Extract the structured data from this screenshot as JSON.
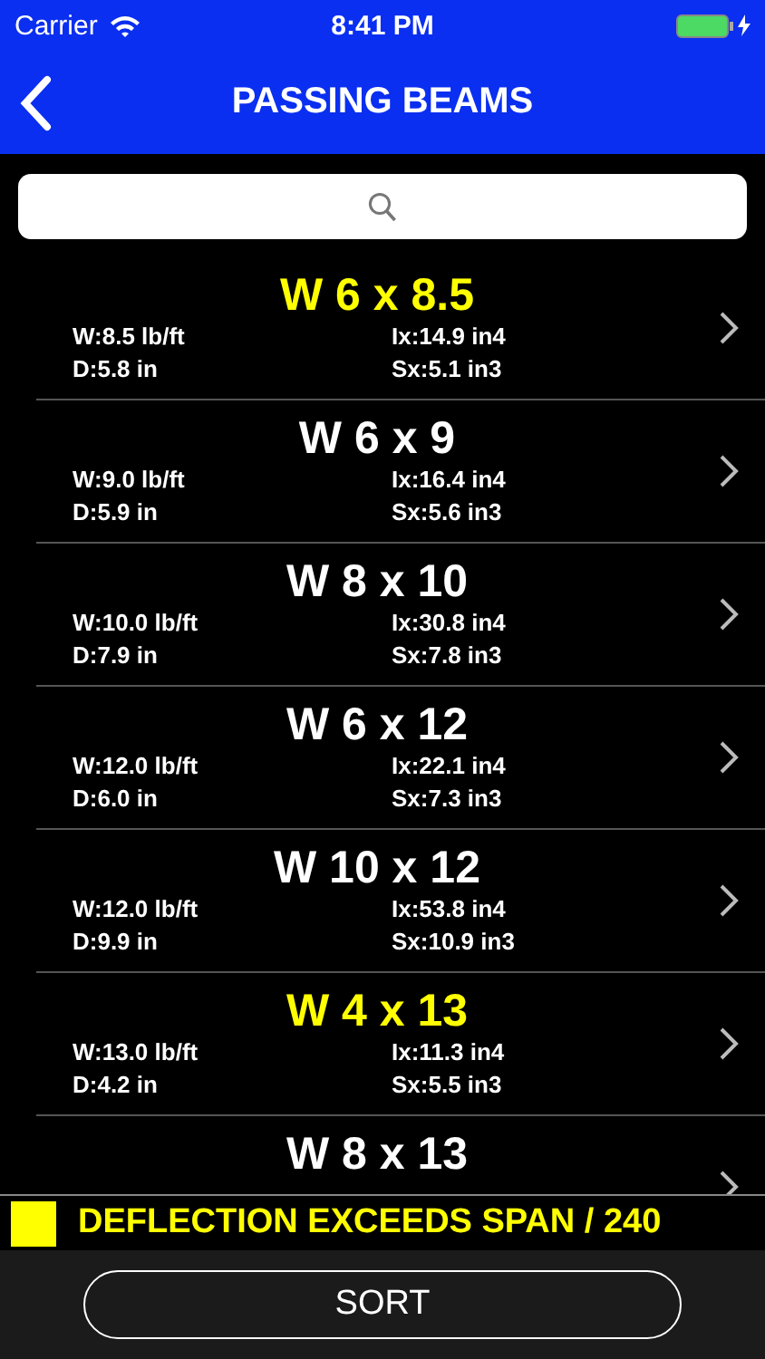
{
  "status_bar": {
    "carrier": "Carrier",
    "time": "8:41 PM"
  },
  "nav": {
    "title": "PASSING BEAMS"
  },
  "beams": [
    {
      "name": "W 6 x 8.5",
      "exceeds_deflection": true,
      "weight": "W:8.5 lb/ft",
      "ix": "Ix:14.9 in4",
      "depth": "D:5.8 in",
      "sx": "Sx:5.1 in3"
    },
    {
      "name": "W 6 x 9",
      "exceeds_deflection": false,
      "weight": "W:9.0 lb/ft",
      "ix": "Ix:16.4 in4",
      "depth": "D:5.9 in",
      "sx": "Sx:5.6 in3"
    },
    {
      "name": "W 8 x 10",
      "exceeds_deflection": false,
      "weight": "W:10.0 lb/ft",
      "ix": "Ix:30.8 in4",
      "depth": "D:7.9 in",
      "sx": "Sx:7.8 in3"
    },
    {
      "name": "W 6 x 12",
      "exceeds_deflection": false,
      "weight": "W:12.0 lb/ft",
      "ix": "Ix:22.1 in4",
      "depth": "D:6.0 in",
      "sx": "Sx:7.3 in3"
    },
    {
      "name": "W 10 x 12",
      "exceeds_deflection": false,
      "weight": "W:12.0 lb/ft",
      "ix": "Ix:53.8 in4",
      "depth": "D:9.9 in",
      "sx": "Sx:10.9 in3"
    },
    {
      "name": "W 4 x 13",
      "exceeds_deflection": true,
      "weight": "W:13.0 lb/ft",
      "ix": "Ix:11.3 in4",
      "depth": "D:4.2 in",
      "sx": "Sx:5.5 in3"
    },
    {
      "name": "W 8 x 13",
      "exceeds_deflection": false
    }
  ],
  "legend": {
    "label": "DEFLECTION EXCEEDS SPAN / 240",
    "color": "#ffff00"
  },
  "sort_button": {
    "label": "SORT"
  }
}
